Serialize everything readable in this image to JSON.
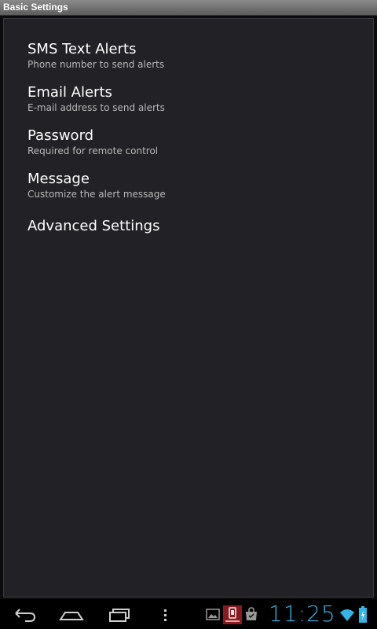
{
  "window": {
    "title": "Basic Settings"
  },
  "preferences": [
    {
      "title": "SMS Text Alerts",
      "summary": "Phone number to send alerts"
    },
    {
      "title": "Email Alerts",
      "summary": "E-mail address to send alerts"
    },
    {
      "title": "Password",
      "summary": "Required for remote control"
    },
    {
      "title": "Message",
      "summary": "Customize the alert message"
    },
    {
      "title": "Advanced Settings"
    }
  ],
  "navbar": {
    "buttons": [
      "back-icon",
      "home-icon",
      "recent-apps-icon",
      "menu-icon"
    ],
    "notifications": [
      "gallery-icon",
      "app-notification-icon",
      "shopping-bag-icon"
    ],
    "clock": "11:25",
    "status_icons": [
      "wifi-icon",
      "battery-icon"
    ],
    "accent_color": "#33b5e5"
  }
}
